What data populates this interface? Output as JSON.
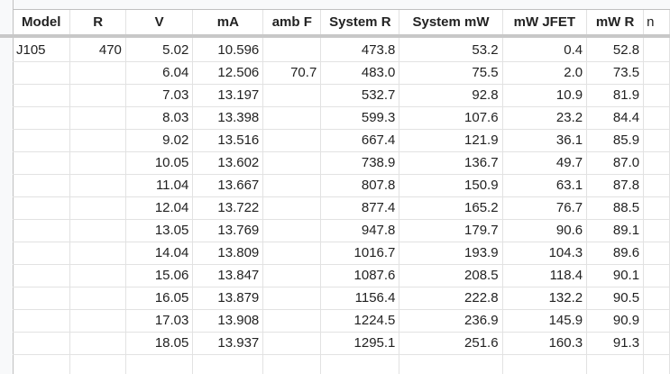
{
  "table": {
    "headers": [
      "Model",
      "R",
      "V",
      "mA",
      "amb F",
      "System R",
      "System mW",
      "mW JFET",
      "mW R",
      "n"
    ],
    "rows": [
      [
        "J105",
        "470",
        "5.02",
        "10.596",
        "",
        "473.8",
        "53.2",
        "0.4",
        "52.8",
        ""
      ],
      [
        "",
        "",
        "6.04",
        "12.506",
        "70.7",
        "483.0",
        "75.5",
        "2.0",
        "73.5",
        ""
      ],
      [
        "",
        "",
        "7.03",
        "13.197",
        "",
        "532.7",
        "92.8",
        "10.9",
        "81.9",
        ""
      ],
      [
        "",
        "",
        "8.03",
        "13.398",
        "",
        "599.3",
        "107.6",
        "23.2",
        "84.4",
        ""
      ],
      [
        "",
        "",
        "9.02",
        "13.516",
        "",
        "667.4",
        "121.9",
        "36.1",
        "85.9",
        ""
      ],
      [
        "",
        "",
        "10.05",
        "13.602",
        "",
        "738.9",
        "136.7",
        "49.7",
        "87.0",
        ""
      ],
      [
        "",
        "",
        "11.04",
        "13.667",
        "",
        "807.8",
        "150.9",
        "63.1",
        "87.8",
        ""
      ],
      [
        "",
        "",
        "12.04",
        "13.722",
        "",
        "877.4",
        "165.2",
        "76.7",
        "88.5",
        ""
      ],
      [
        "",
        "",
        "13.05",
        "13.769",
        "",
        "947.8",
        "179.7",
        "90.6",
        "89.1",
        ""
      ],
      [
        "",
        "",
        "14.04",
        "13.809",
        "",
        "1016.7",
        "193.9",
        "104.3",
        "89.6",
        ""
      ],
      [
        "",
        "",
        "15.06",
        "13.847",
        "",
        "1087.6",
        "208.5",
        "118.4",
        "90.1",
        ""
      ],
      [
        "",
        "",
        "16.05",
        "13.879",
        "",
        "1156.4",
        "222.8",
        "132.2",
        "90.5",
        ""
      ],
      [
        "",
        "",
        "17.03",
        "13.908",
        "",
        "1224.5",
        "236.9",
        "145.9",
        "90.9",
        ""
      ],
      [
        "",
        "",
        "18.05",
        "13.937",
        "",
        "1295.1",
        "251.6",
        "160.3",
        "91.3",
        ""
      ],
      [
        "",
        "",
        "",
        "",
        "",
        "",
        "",
        "",
        "",
        ""
      ]
    ]
  }
}
